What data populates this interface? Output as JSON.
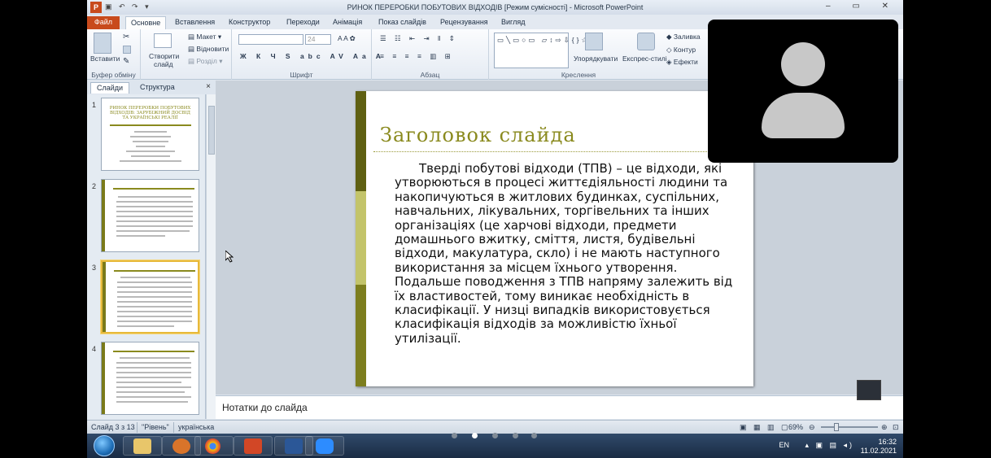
{
  "window": {
    "title": "РИНОК ПЕРЕРОБКИ ПОБУТОВИХ ВІДХОДІВ [Режим сумісності] - Microsoft PowerPoint",
    "app_icon": "P"
  },
  "ribbon_tabs": [
    "Файл",
    "Основне",
    "Вставлення",
    "Конструктор",
    "Переходи",
    "Анімація",
    "Показ слайдів",
    "Рецензування",
    "Вигляд"
  ],
  "ribbon": {
    "clipboard": {
      "paste_label": "Вставити",
      "group_label": "Буфер обміну"
    },
    "slides": {
      "new_slide_label_1": "Створити",
      "new_slide_label_2": "слайд",
      "layout_label": "Макет",
      "reset_label": "Відновити",
      "section_label": "Розділ"
    },
    "font": {
      "font_size": "24",
      "group_label": "Шрифт"
    },
    "paragraph": {
      "group_label": "Абзац"
    },
    "drawing": {
      "arrange_label": "Упорядкувати",
      "quick_styles_label": "Експрес-стилі",
      "fill_label": "Заливка",
      "outline_label": "Контур",
      "effects_label": "Ефекти",
      "group_label": "Креслення"
    }
  },
  "pane_tabs": {
    "slides": "Слайди",
    "outline": "Структура",
    "close": "×"
  },
  "thumbnails": [
    {
      "num": "1",
      "title_lines": [
        "РИНОК ПЕРЕРОБКИ ПОБУТОВИХ",
        "ВІДХОДІВ: ЗАРУБІЖНИЙ ДОСВІД",
        "ТА УКРАЇНСЬКІ РЕАЛІЇ"
      ]
    },
    {
      "num": "2"
    },
    {
      "num": "3"
    },
    {
      "num": "4"
    }
  ],
  "slide": {
    "title": "Заголовок слайда",
    "body": "Тверді побутові відходи (ТПВ) – це відходи, які утворюються в процесі життєдіяльності людини та накопичуються в житлових будинках, суспільних, навчальних, лікувальних, торгівельних та інших організаціях (це харчові відходи, предмети домашнього вжитку, сміття, листя, будівельні відходи, макулатура, скло) і не мають наступного використання за місцем їхнього утворення. Подальше поводження з ТПВ напряму залежить від їх властивостей, тому виникає необхідність в класифікації. У низці випадків використовується класифікація відходів за можливістю їхньої утилізації."
  },
  "notes_placeholder": "Нотатки до слайда",
  "status": {
    "slide_info": "Слайд 3 з 13",
    "theme": "\"Рівень\"",
    "language": "українська",
    "zoom": "69%"
  },
  "tray": {
    "lang": "EN",
    "time": "16:32",
    "date": "11.02.2021"
  },
  "colors": {
    "accent_band": "#7d7e1e",
    "title": "#8a8a1e",
    "file_tab": "#c84a1c"
  }
}
